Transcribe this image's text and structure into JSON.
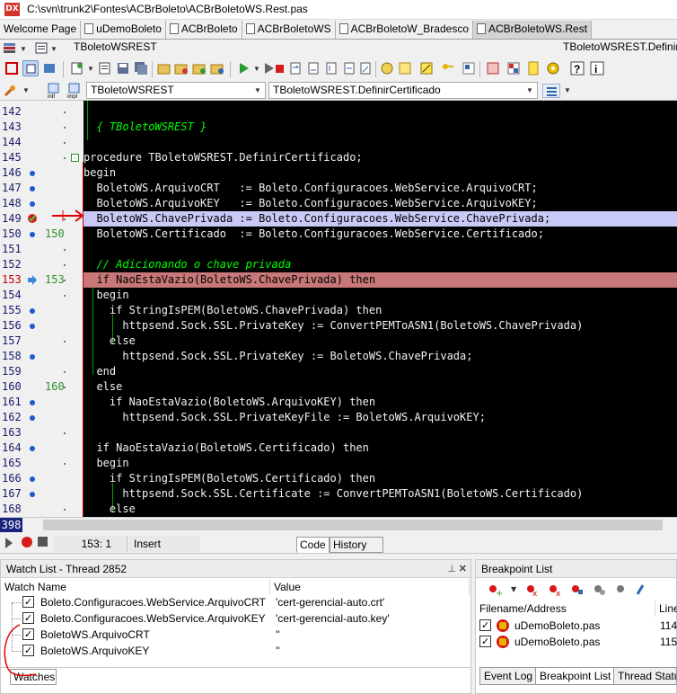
{
  "window": {
    "title": "C:\\svn\\trunk2\\Fontes\\ACBrBoleto\\ACBrBoletoWS.Rest.pas",
    "app_icon_text": "DX"
  },
  "file_tabs": [
    {
      "label": "Welcome Page",
      "active": false
    },
    {
      "label": "uDemoBoleto",
      "active": false
    },
    {
      "label": "ACBrBoleto",
      "active": false
    },
    {
      "label": "ACBrBoletoWS",
      "active": false
    },
    {
      "label": "ACBrBoletoW_Bradesco",
      "active": false
    },
    {
      "label": "ACBrBoletoWS.Rest",
      "active": true
    }
  ],
  "row2": {
    "class_combo": "TBoletoWSREST",
    "method_combo": "TBoletoWSREST.DefinirCertificado"
  },
  "row4": {
    "class_combo": "TBoletoWSREST",
    "method_combo": "TBoletoWSREST.DefinirCertificado"
  },
  "editor": {
    "lines": [
      {
        "n": "142",
        "text": "",
        "bp": false,
        "mark": ""
      },
      {
        "n": "143",
        "text": "  { TBoletoWSREST }",
        "comment": true,
        "bp": false,
        "mark": ""
      },
      {
        "n": "144",
        "text": "",
        "bp": false,
        "mark": ""
      },
      {
        "n": "145",
        "text": "procedure TBoletoWSREST.DefinirCertificado;",
        "bp": false,
        "mark": "",
        "fold": "-"
      },
      {
        "n": "146",
        "text": "begin",
        "bp": true,
        "mark": ""
      },
      {
        "n": "147",
        "text": "  BoletoWS.ArquivoCRT   := Boleto.Configuracoes.WebService.ArquivoCRT;",
        "bp": true,
        "mark": ""
      },
      {
        "n": "148",
        "text": "  BoletoWS.ArquivoKEY   := Boleto.Configuracoes.WebService.ArquivoKEY;",
        "bp": true,
        "mark": ""
      },
      {
        "n": "149",
        "text": "  BoletoWS.ChavePrivada := Boleto.Configuracoes.WebService.ChavePrivada;",
        "bp": false,
        "mark": "",
        "hl": "blue"
      },
      {
        "n": "150",
        "text": "  BoletoWS.Certificado  := Boleto.Configuracoes.WebService.Certificado;",
        "bp": true,
        "mark": "150"
      },
      {
        "n": "151",
        "text": "",
        "bp": false,
        "mark": ""
      },
      {
        "n": "152",
        "text": "  // Adicionando o chave privada",
        "comment": true,
        "bp": false,
        "mark": ""
      },
      {
        "n": "153",
        "text": "  if NaoEstaVazio(BoletoWS.ChavePrivada) then",
        "bp": false,
        "mark": "153",
        "hl": "red",
        "err": true
      },
      {
        "n": "154",
        "text": "  begin",
        "bp": false,
        "mark": ""
      },
      {
        "n": "155",
        "text": "    if StringIsPEM(BoletoWS.ChavePrivada) then",
        "bp": true,
        "mark": ""
      },
      {
        "n": "156",
        "text": "      httpsend.Sock.SSL.PrivateKey := ConvertPEMToASN1(BoletoWS.ChavePrivada)",
        "bp": true,
        "mark": ""
      },
      {
        "n": "157",
        "text": "    else",
        "bp": false,
        "mark": ""
      },
      {
        "n": "158",
        "text": "      httpsend.Sock.SSL.PrivateKey := BoletoWS.ChavePrivada;",
        "bp": true,
        "mark": ""
      },
      {
        "n": "159",
        "text": "  end",
        "bp": false,
        "mark": ""
      },
      {
        "n": "160",
        "text": "  else",
        "bp": false,
        "mark": "160"
      },
      {
        "n": "161",
        "text": "    if NaoEstaVazio(BoletoWS.ArquivoKEY) then",
        "bp": true,
        "mark": ""
      },
      {
        "n": "162",
        "text": "      httpsend.Sock.SSL.PrivateKeyFile := BoletoWS.ArquivoKEY;",
        "bp": true,
        "mark": ""
      },
      {
        "n": "163",
        "text": "",
        "bp": false,
        "mark": ""
      },
      {
        "n": "164",
        "text": "  if NaoEstaVazio(BoletoWS.Certificado) then",
        "bp": true,
        "mark": ""
      },
      {
        "n": "165",
        "text": "  begin",
        "bp": false,
        "mark": ""
      },
      {
        "n": "166",
        "text": "    if StringIsPEM(BoletoWS.Certificado) then",
        "bp": true,
        "mark": ""
      },
      {
        "n": "167",
        "text": "      httpsend.Sock.SSL.Certificate := ConvertPEMToASN1(BoletoWS.Certificado)",
        "bp": true,
        "mark": ""
      },
      {
        "n": "168",
        "text": "    else",
        "bp": false,
        "mark": ""
      }
    ]
  },
  "scroll": {
    "line_indicator": "398"
  },
  "status": {
    "caret": "153:  1",
    "mode": "Insert",
    "tab_code": "Code",
    "tab_history": "History"
  },
  "watch": {
    "title": "Watch List - Thread 2852",
    "col_name": "Watch Name",
    "col_value": "Value",
    "rows": [
      {
        "name": "Boleto.Configuracoes.WebService.ArquivoCRT",
        "value": "'cert-gerencial-auto.crt'"
      },
      {
        "name": "Boleto.Configuracoes.WebService.ArquivoKEY",
        "value": "'cert-gerencial-auto.key'"
      },
      {
        "name": "BoletoWS.ArquivoCRT",
        "value": "''"
      },
      {
        "name": "BoletoWS.ArquivoKEY",
        "value": "''"
      }
    ],
    "bottom_tab": "Watches"
  },
  "breakpoints": {
    "title": "Breakpoint List",
    "col_file": "Filename/Address",
    "col_line": "Line",
    "rows": [
      {
        "file": "uDemoBoleto.pas",
        "line": "114"
      },
      {
        "file": "uDemoBoleto.pas",
        "line": "115"
      }
    ],
    "tabs": [
      "Event Log",
      "Breakpoint List",
      "Thread Status"
    ]
  }
}
